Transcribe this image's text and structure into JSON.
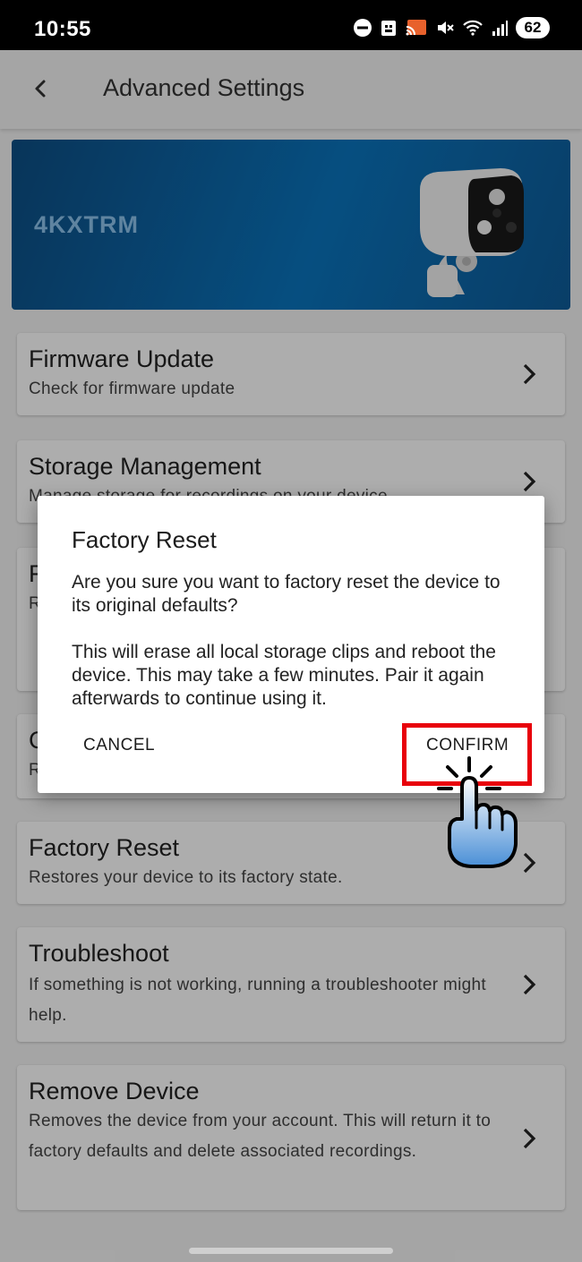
{
  "status_bar": {
    "time": "10:55",
    "battery": "62",
    "icons": [
      "dnd-icon",
      "notification-icon",
      "cast-icon",
      "mute-icon",
      "wifi-icon",
      "signal-icon"
    ]
  },
  "header": {
    "title": "Advanced Settings",
    "back_icon": "chevron-left-icon"
  },
  "banner": {
    "device_name": "4KXTRM",
    "image": "security-camera"
  },
  "settings": [
    {
      "title": "Firmware Update",
      "desc": "Check for firmware update"
    },
    {
      "title": "Storage Management",
      "desc": "Manage storage for recordings on your device"
    },
    {
      "title": "F",
      "desc": "R"
    },
    {
      "title": "C",
      "desc": "R"
    },
    {
      "title": "Factory Reset",
      "desc": "Restores your device to its factory state."
    },
    {
      "title": "Troubleshoot",
      "desc": "If something is not working, running a troubleshooter might help."
    },
    {
      "title": "Remove Device",
      "desc": "Removes the device from your account. This will return it to factory defaults and delete associated recordings."
    }
  ],
  "dialog": {
    "title": "Factory Reset",
    "message_1": "Are you sure you want to factory reset the device to its original defaults?",
    "message_2": "This will erase all local storage clips and reboot the device. This may take a few minutes. Pair it again afterwards to continue using it.",
    "cancel_label": "CANCEL",
    "confirm_label": "CONFIRM"
  },
  "colors": {
    "highlight": "#e8000b",
    "banner": "#0a74bd"
  }
}
